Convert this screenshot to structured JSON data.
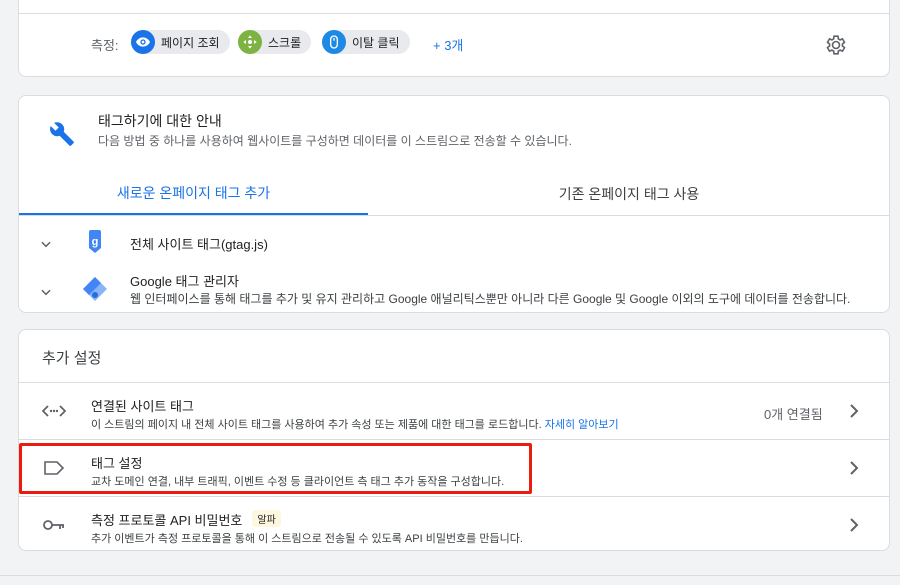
{
  "metrics": {
    "label": "측정:",
    "chips": [
      {
        "label": "페이지 조회",
        "icon": "eye-icon",
        "color": "#1a73e8"
      },
      {
        "label": "스크롤",
        "icon": "scroll-arrows-icon",
        "color": "#7cb342"
      },
      {
        "label": "이탈 클릭",
        "icon": "mouse-icon",
        "color": "#1e88e5"
      }
    ],
    "more": "+ 3개"
  },
  "tagging": {
    "title": "태그하기에 대한 안내",
    "subtitle": "다음 방법 중 하나를 사용하여 웹사이트를 구성하면 데이터를 이 스트림으로 전송할 수 있습니다.",
    "tabs": [
      "새로운 온페이지 태그 추가",
      "기존 온페이지 태그 사용"
    ],
    "options": [
      {
        "title": "전체 사이트 태그(gtag.js)",
        "subtitle": ""
      },
      {
        "title": "Google 태그 관리자",
        "subtitle": "웹 인터페이스를 통해 태그를 추가 및 유지 관리하고 Google 애널리틱스뿐만 아니라 다른 Google 및 Google 이외의 도구에 데이터를 전송합니다."
      }
    ]
  },
  "extra": {
    "title": "추가 설정",
    "rows": [
      {
        "title": "연결된 사이트 태그",
        "subtitle": "이 스트림의 페이지 내 전체 사이트 태그를 사용하여 추가 속성 또는 제품에 대한 태그를 로드합니다.",
        "link": "자세히 알아보기",
        "status": "0개 연결됨"
      },
      {
        "title": "태그 설정",
        "subtitle": "교차 도메인 연결, 내부 트래픽, 이벤트 수정 등 클라이언트 측 태그 추가 동작을 구성합니다."
      },
      {
        "title": "측정 프로토콜 API 비밀번호",
        "badge": "알파",
        "subtitle": "추가 이벤트가 측정 프로토콜을 통해 이 스트림으로 전송될 수 있도록 API 비밀번호를 만듭니다."
      }
    ]
  },
  "colors": {
    "accent": "#1a73e8",
    "highlight": "#ea1c0d"
  }
}
